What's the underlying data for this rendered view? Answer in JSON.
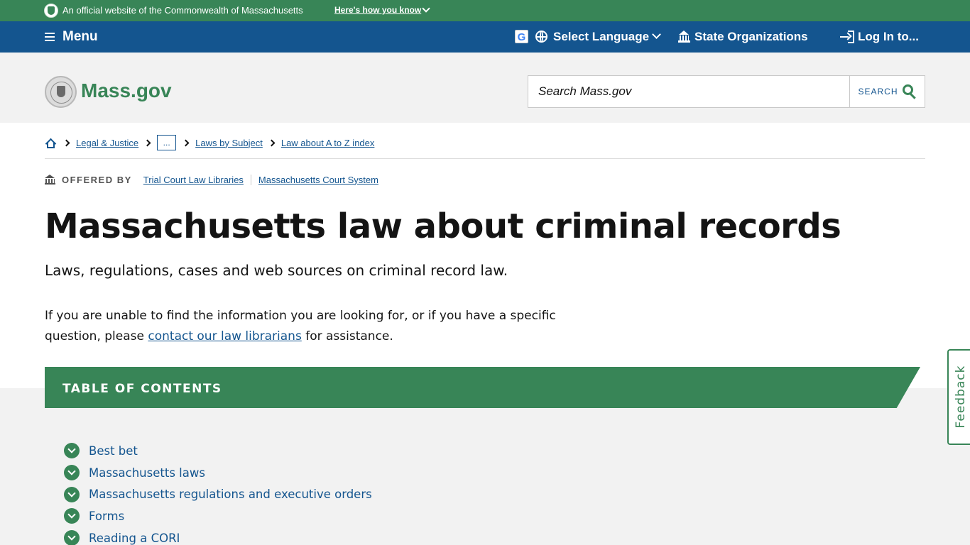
{
  "official_bar": {
    "text": "An official website of the Commonwealth of Massachusetts",
    "how_link": "Here's how you know"
  },
  "util_nav": {
    "menu": "Menu",
    "select_language": "Select Language",
    "state_orgs": "State Organizations",
    "login": "Log In to..."
  },
  "header": {
    "logo": "Mass.gov",
    "search_placeholder": "Search Mass.gov",
    "search_button": "SEARCH"
  },
  "breadcrumb": {
    "items": [
      "Legal & Justice",
      "...",
      "Laws by Subject",
      "Law about A to Z index"
    ]
  },
  "offered_by": {
    "label": "OFFERED BY",
    "orgs": [
      "Trial Court Law Libraries",
      "Massachusetts Court System"
    ]
  },
  "page": {
    "title": "Massachusetts law about criminal records",
    "subtitle": "Laws, regulations, cases and web sources on criminal record law.",
    "intro_before": "If you are unable to find the information you are looking for, or if you have a specific question, please ",
    "intro_link": "contact our law librarians",
    "intro_after": " for assistance."
  },
  "toc": {
    "title": "TABLE OF CONTENTS",
    "items": [
      "Best bet",
      "Massachusetts laws",
      "Massachusetts regulations and executive orders",
      "Forms",
      "Reading a CORI"
    ]
  },
  "feedback": "Feedback",
  "colors": {
    "green": "#388557",
    "blue": "#14558f",
    "gray_bg": "#f2f2f2"
  }
}
